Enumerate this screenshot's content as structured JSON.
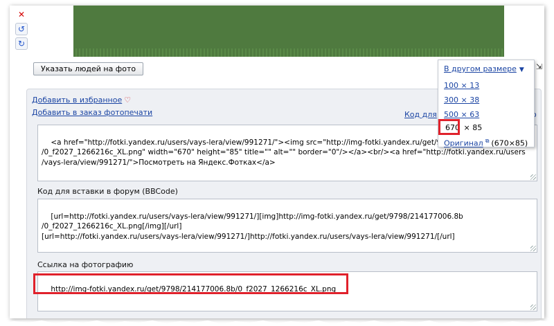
{
  "photo": {
    "tag_people_button": "Указать людей на фото"
  },
  "actions": {
    "favorite": "Добавить в избранное",
    "print_order": "Добавить в заказ фотопечати",
    "code_for": "Код для",
    "code_for_tail": "о"
  },
  "size_menu": {
    "title": "В другом размере",
    "items": [
      "100 × 13",
      "300 × 38",
      "500 × 63"
    ],
    "selected_width": "670",
    "selected_rest": " × 85",
    "original_label": "Оригинал",
    "original_size": "(670×85)"
  },
  "html_code": {
    "value": "<a href=\"http://fotki.yandex.ru/users/vays-lera/view/991271/\"><img src=\"http://img-fotki.yandex.ru/get/9798/214177006.8b\n/0_f2027_1266216c_XL.png\" width=\"670\" height=\"85\" title=\"\" alt=\"\" border=\"0\"/></a><br/><a href=\"http://fotki.yandex.ru/users\n/vays-lera/view/991271/\">Посмотреть на Яндекс.Фотках</a>"
  },
  "bbcode": {
    "label": "Код для вставки в форум (BBCode)",
    "value": "[url=http://fotki.yandex.ru/users/vays-lera/view/991271/][img]http://img-fotki.yandex.ru/get/9798/214177006.8b\n/0_f2027_1266216c_XL.png[/img][/url]\n[url=http://fotki.yandex.ru/users/vays-lera/view/991271/]http://fotki.yandex.ru/users/vays-lera/view/991271/[/url]"
  },
  "photo_link": {
    "label": "Ссылка на фотографию",
    "value": "http://img-fotki.yandex.ru/get/9798/214177006.8b/0_f2027_1266216c_XL.png"
  },
  "colors": {
    "highlight": "#e0212b",
    "link": "#1a44a3",
    "photo": "#4f7a3f"
  }
}
